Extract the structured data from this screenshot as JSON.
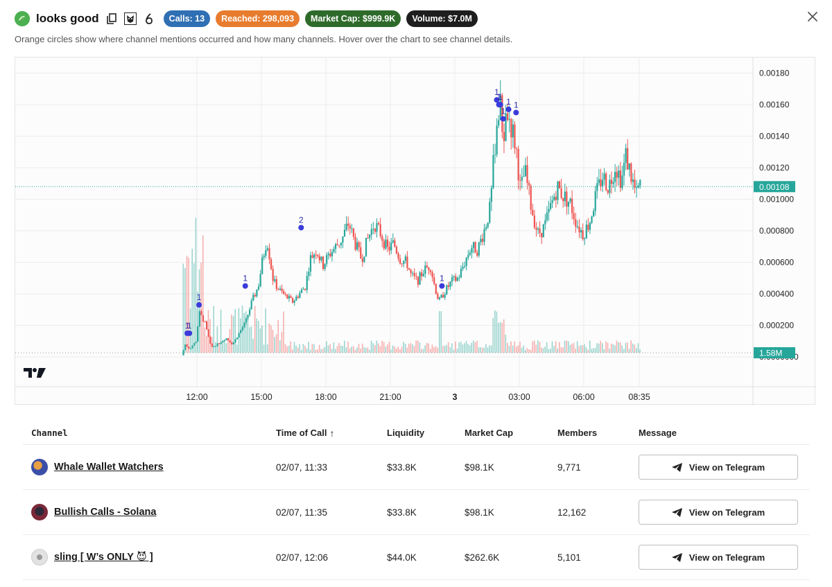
{
  "header": {
    "token_name": "looks good",
    "badges": {
      "calls": "Calls: 13",
      "reached": "Reached: 298,093",
      "market_cap": "Market Cap: $999.9K",
      "volume": "Volume: $7.0M"
    },
    "icons": [
      "token-logo-icon",
      "copy-icon",
      "rugcheck-icon",
      "pump-icon",
      "close-icon"
    ]
  },
  "subtitle": "Orange circles show where channel mentions occurred and how many channels. Hover over the chart to see channel details.",
  "chart_data": {
    "type": "candlestick",
    "y_ticks": [
      "0.00180",
      "0.00160",
      "0.00140",
      "0.00120",
      "0.001000",
      "0.000800",
      "0.000600",
      "0.000400",
      "0.000200",
      "0.0000000"
    ],
    "x_ticks": [
      "12:00",
      "15:00",
      "18:00",
      "21:00",
      "3",
      "03:00",
      "06:00",
      "08:35"
    ],
    "ylim": [
      0,
      0.0019
    ],
    "last_price_label": "0.00108",
    "last_price": 0.00108,
    "volume_label": "1.58M",
    "grid": true,
    "colors": {
      "up": "#26a69a",
      "down": "#ef5350",
      "marker": "#3b3bdb",
      "price_line": "#26a69a"
    },
    "price_path": [
      [
        11.33,
        1e-05
      ],
      [
        11.5,
        8e-05
      ],
      [
        11.7,
        5e-05
      ],
      [
        12.0,
        0.0001
      ],
      [
        12.15,
        0.00028
      ],
      [
        12.4,
        0.00022
      ],
      [
        12.7,
        6e-05
      ],
      [
        13.0,
        8e-05
      ],
      [
        13.4,
        0.00012
      ],
      [
        13.7,
        8e-05
      ],
      [
        14.0,
        0.00015
      ],
      [
        14.3,
        0.00022
      ],
      [
        14.6,
        0.00035
      ],
      [
        14.9,
        0.00045
      ],
      [
        15.1,
        0.00062
      ],
      [
        15.3,
        0.00075
      ],
      [
        15.6,
        0.00048
      ],
      [
        15.9,
        0.00042
      ],
      [
        16.2,
        0.00038
      ],
      [
        16.5,
        0.00035
      ],
      [
        16.8,
        0.0004
      ],
      [
        17.1,
        0.00045
      ],
      [
        17.3,
        0.00062
      ],
      [
        17.6,
        0.00068
      ],
      [
        17.9,
        0.00058
      ],
      [
        18.2,
        0.00065
      ],
      [
        18.5,
        0.0007
      ],
      [
        18.8,
        0.00075
      ],
      [
        19.1,
        0.00085
      ],
      [
        19.4,
        0.00072
      ],
      [
        19.7,
        0.00062
      ],
      [
        20.0,
        0.00075
      ],
      [
        20.3,
        0.00085
      ],
      [
        20.6,
        0.00078
      ],
      [
        20.9,
        0.00068
      ],
      [
        21.2,
        0.00072
      ],
      [
        21.5,
        0.00062
      ],
      [
        21.8,
        0.0006
      ],
      [
        22.0,
        0.00052
      ],
      [
        22.3,
        0.00048
      ],
      [
        22.6,
        0.00055
      ],
      [
        22.9,
        0.00058
      ],
      [
        23.1,
        0.00045
      ],
      [
        23.3,
        0.00035
      ],
      [
        23.6,
        0.00042
      ],
      [
        23.9,
        0.00048
      ],
      [
        24.2,
        0.0005
      ],
      [
        24.5,
        0.0006
      ],
      [
        24.8,
        0.0007
      ],
      [
        25.1,
        0.00068
      ],
      [
        25.4,
        0.0008
      ],
      [
        25.7,
        0.00095
      ],
      [
        25.85,
        0.00125
      ],
      [
        26.0,
        0.0015
      ],
      [
        26.15,
        0.0016
      ],
      [
        26.3,
        0.0014
      ],
      [
        26.5,
        0.00155
      ],
      [
        26.7,
        0.00145
      ],
      [
        26.9,
        0.00132
      ],
      [
        27.1,
        0.00105
      ],
      [
        27.3,
        0.00118
      ],
      [
        27.6,
        0.00095
      ],
      [
        27.9,
        0.00078
      ],
      [
        28.2,
        0.00082
      ],
      [
        28.5,
        0.00095
      ],
      [
        28.8,
        0.00108
      ],
      [
        29.1,
        0.00102
      ],
      [
        29.4,
        0.00098
      ],
      [
        29.7,
        0.00085
      ],
      [
        30.0,
        0.00078
      ],
      [
        30.3,
        0.00085
      ],
      [
        30.6,
        0.00102
      ],
      [
        30.9,
        0.00115
      ],
      [
        31.2,
        0.00108
      ],
      [
        31.5,
        0.00122
      ],
      [
        31.8,
        0.00112
      ],
      [
        32.0,
        0.00128
      ],
      [
        32.3,
        0.00112
      ],
      [
        32.5,
        0.00102
      ],
      [
        32.6,
        0.00108
      ]
    ],
    "mention_markers": [
      {
        "t": 11.55,
        "price": 0.00015,
        "label": "1"
      },
      {
        "t": 11.65,
        "price": 0.00015,
        "label": "1"
      },
      {
        "t": 12.1,
        "price": 0.00033,
        "label": "1"
      },
      {
        "t": 14.25,
        "price": 0.00045,
        "label": "1"
      },
      {
        "t": 16.85,
        "price": 0.00082,
        "label": "2"
      },
      {
        "t": 23.4,
        "price": 0.00045,
        "label": "1"
      },
      {
        "t": 25.95,
        "price": 0.00163,
        "label": "1"
      },
      {
        "t": 26.05,
        "price": 0.0016,
        "label": "1"
      },
      {
        "t": 26.12,
        "price": 0.0016,
        "label": "1"
      },
      {
        "t": 26.25,
        "price": 0.00151,
        "label": "1"
      },
      {
        "t": 26.5,
        "price": 0.00157,
        "label": "1"
      },
      {
        "t": 26.85,
        "price": 0.00155,
        "label": "1"
      }
    ]
  },
  "table": {
    "headers": {
      "channel": "Channel",
      "time_of_call": "Time of Call",
      "liquidity": "Liquidity",
      "market_cap": "Market Cap",
      "members": "Members",
      "message": "Message"
    },
    "sort_indicator": "↑",
    "rows": [
      {
        "channel": "Whale Wallet Watchers",
        "time": "02/07, 11:33",
        "liquidity": "$33.8K",
        "market_cap": "$98.1K",
        "members": "9,771",
        "button": "View on Telegram",
        "avatar_color": "#3a4fa8"
      },
      {
        "channel": "Bullish Calls - Solana",
        "time": "02/07, 11:35",
        "liquidity": "$33.8K",
        "market_cap": "$98.1K",
        "members": "12,162",
        "button": "View on Telegram",
        "avatar_color": "#7a2838"
      },
      {
        "channel": "sling [ W’s ONLY 😈 ]",
        "time": "02/07, 12:06",
        "liquidity": "$44.0K",
        "market_cap": "$262.6K",
        "members": "5,101",
        "button": "View on Telegram",
        "avatar_color": "#d8d8d8"
      }
    ]
  }
}
